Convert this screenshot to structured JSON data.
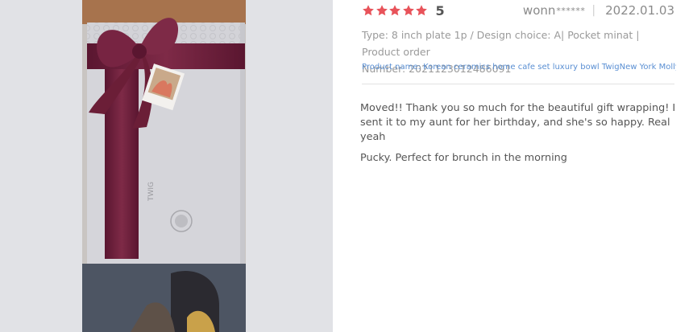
{
  "review": {
    "rating_stars": 5,
    "rating_value": "5",
    "author": "wonn",
    "author_mask": "******",
    "separator": "|",
    "date": "2022.01.03",
    "options_line1": "Type: 8 inch plate 1p / Design choice: A| Pocket minat | Product order",
    "options_line2": "Number: 2021123012486091",
    "product_label": "Product name: ",
    "product_name": "Korean ceramics home cafe set luxury bowl TwigNew York Molly...",
    "content_line1": "Moved!! Thank you so much for the beautiful gift wrapping! I sent it to my aunt for her birthday, and she's so happy. Real yeah",
    "content_line2": "Pucky. Perfect for brunch in the morning"
  },
  "colors": {
    "star": "#e8535a",
    "panel_bg": "#e1e2e6",
    "ribbon": "#6b1e37",
    "box": "#d6d6da",
    "link": "#5a8fd3"
  },
  "photo": {
    "box_print": "TWIG"
  }
}
